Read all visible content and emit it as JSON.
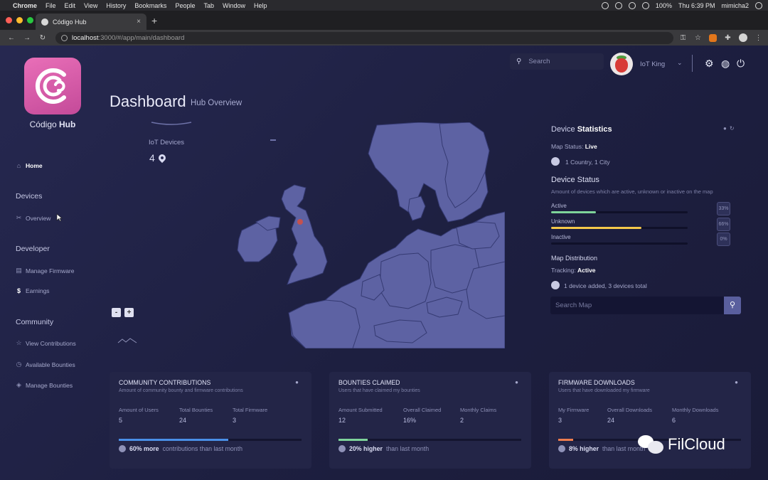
{
  "menubar": {
    "apple": "",
    "items": [
      "Chrome",
      "File",
      "Edit",
      "View",
      "History",
      "Bookmarks",
      "People",
      "Tab",
      "Window",
      "Help"
    ],
    "battery": "100%",
    "clock": "Thu 6:39 PM",
    "user": "mimicha2"
  },
  "browser": {
    "tab_title": "Código Hub",
    "tab_close": "×",
    "new_tab": "+",
    "url_host": "localhost",
    "url_path": ":3000/#/app/main/dashboard"
  },
  "sidebar": {
    "brand_prefix": "Código",
    "brand_suffix": "Hub",
    "home": "Home",
    "devices_heading": "Devices",
    "overview": "Overview",
    "developer_heading": "Developer",
    "manage_firmware": "Manage Firmware",
    "earnings": "Earnings",
    "community_heading": "Community",
    "view_contributions": "View Contributions",
    "available_bounties": "Available Bounties",
    "manage_bounties": "Manage Bounties"
  },
  "header": {
    "title": "Dashboard",
    "subtitle": "Hub Overview",
    "search_placeholder": "Search",
    "user_name": "IoT King"
  },
  "iot": {
    "label": "IoT Devices",
    "count": "4"
  },
  "map": {
    "zoom_in": "+",
    "zoom_out": "-",
    "marker_color": "#c4514f"
  },
  "device_stats": {
    "title_prefix": "Device",
    "title_bold": "Statistics",
    "map_status_label": "Map Status:",
    "map_status_value": "Live",
    "location_text": "1 Country, 1 City",
    "device_status_title": "Device Status",
    "device_status_desc": "Amount of devices which are active, unknown or inactive on the map",
    "statuses": [
      {
        "label": "Active",
        "percent_text": "33%",
        "fill": 0.33,
        "color": "#7ed39a"
      },
      {
        "label": "Unknown",
        "percent_text": "66%",
        "fill": 0.66,
        "color": "#f4c84a"
      },
      {
        "label": "Inactive",
        "percent_text": "0%",
        "fill": 0,
        "color": "#8f92b8"
      }
    ],
    "distribution_title": "Map Distribution",
    "tracking_label": "Tracking:",
    "tracking_value": "Active",
    "distribution_text": "1 device added, 3 devices total",
    "map_search_placeholder": "Search Map"
  },
  "cards": [
    {
      "title": "COMMUNITY CONTRIBUTIONS",
      "subtitle": "Amount of community bounty and firmware contributions",
      "stats": [
        {
          "label": "Amount of Users",
          "value": "5"
        },
        {
          "label": "Total Bounties",
          "value": "24"
        },
        {
          "label": "Total Firmware",
          "value": "3"
        }
      ],
      "progress": 0.6,
      "color": "#4a8fe7",
      "footer_bold": "60% more",
      "footer_rest": "contributions than last month"
    },
    {
      "title": "BOUNTIES CLAIMED",
      "subtitle": "Users that have claimed my bounties",
      "stats": [
        {
          "label": "Amount Submitted",
          "value": "12"
        },
        {
          "label": "Overall Claimed",
          "value": "16%"
        },
        {
          "label": "Monthly Claims",
          "value": "2"
        }
      ],
      "progress": 0.16,
      "color": "#7ed39a",
      "footer_bold": "20% higher",
      "footer_rest": "than last month"
    },
    {
      "title": "FIRMWARE DOWNLOADS",
      "subtitle": "Users that have downloaded my firmware",
      "stats": [
        {
          "label": "My Firmware",
          "value": "3"
        },
        {
          "label": "Overall Downloads",
          "value": "24"
        },
        {
          "label": "Monthly Downloads",
          "value": "6"
        }
      ],
      "progress": 0.08,
      "color": "#ef7d4f",
      "footer_bold": "8% higher",
      "footer_rest": "than last month"
    }
  ],
  "watermark": {
    "text": "FilCloud"
  }
}
